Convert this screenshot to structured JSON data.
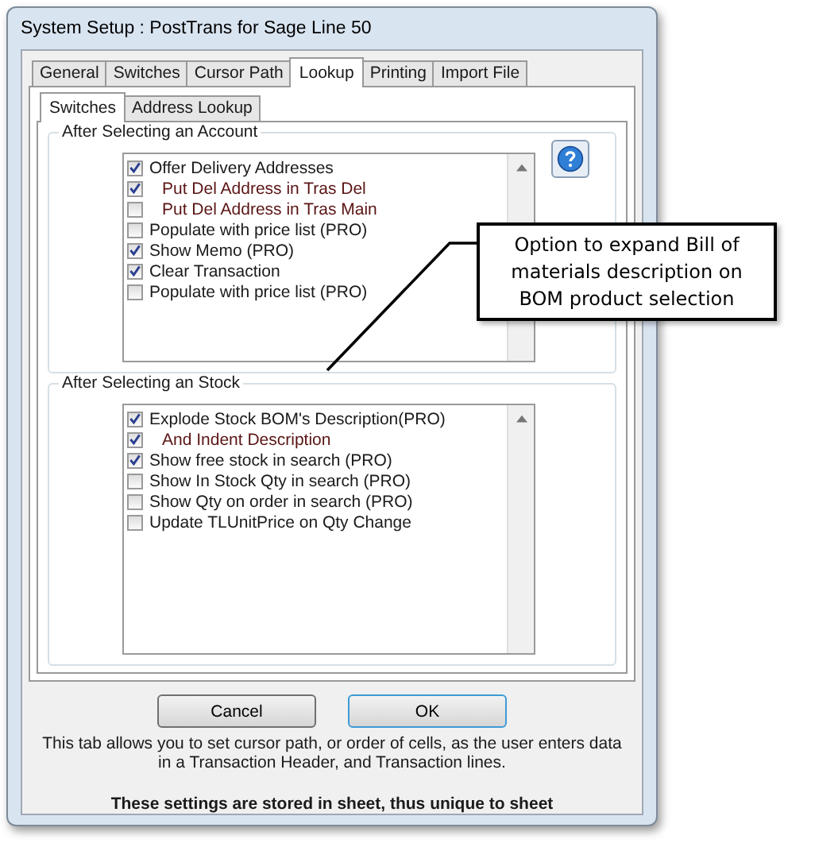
{
  "window": {
    "title": "System Setup : PostTrans for Sage Line 50"
  },
  "tabs": [
    {
      "label": "General",
      "selected": false
    },
    {
      "label": "Switches",
      "selected": false
    },
    {
      "label": "Cursor Path",
      "selected": false
    },
    {
      "label": "Lookup",
      "selected": true
    },
    {
      "label": "Printing",
      "selected": false
    },
    {
      "label": "Import File",
      "selected": false
    }
  ],
  "subtabs": [
    {
      "label": "Switches",
      "selected": true
    },
    {
      "label": "Address Lookup",
      "selected": false
    }
  ],
  "groups": [
    {
      "title": "After Selecting an Account",
      "help": true,
      "items": [
        {
          "label": "Offer Delivery Addresses",
          "checked": true,
          "children": [
            {
              "label": "Put Del Address in Tras Del",
              "checked": true
            },
            {
              "label": "Put Del Address in Tras Main",
              "checked": false
            }
          ]
        },
        {
          "label": "Populate with price list (PRO)",
          "checked": false
        },
        {
          "label": "Show Memo (PRO)",
          "checked": true
        },
        {
          "label": "Clear Transaction",
          "checked": true
        },
        {
          "label": "Populate with price list (PRO)",
          "checked": false
        }
      ]
    },
    {
      "title": "After Selecting an Stock",
      "help": false,
      "items": [
        {
          "label": "Explode Stock BOM's Description(PRO)",
          "checked": true,
          "children": [
            {
              "label": "And Indent Description",
              "checked": true
            }
          ]
        },
        {
          "label": "Show free stock in search (PRO)",
          "checked": true
        },
        {
          "label": "Show In Stock Qty in search (PRO)",
          "checked": false
        },
        {
          "label": "Show Qty on order in search (PRO)",
          "checked": false
        },
        {
          "label": "Update TLUnitPrice on Qty Change",
          "checked": false
        }
      ]
    }
  ],
  "buttons": [
    {
      "label": "Cancel",
      "kind": "normal"
    },
    {
      "label": "OK",
      "kind": "default"
    }
  ],
  "info": "This tab allows you to set cursor path, or order of cells, as the user enters data in a Transaction Header, and Transaction lines.",
  "note": "These settings are stored in sheet, thus unique to sheet",
  "callout": {
    "text": "Option to expand Bill of materials description on BOM product selection"
  }
}
